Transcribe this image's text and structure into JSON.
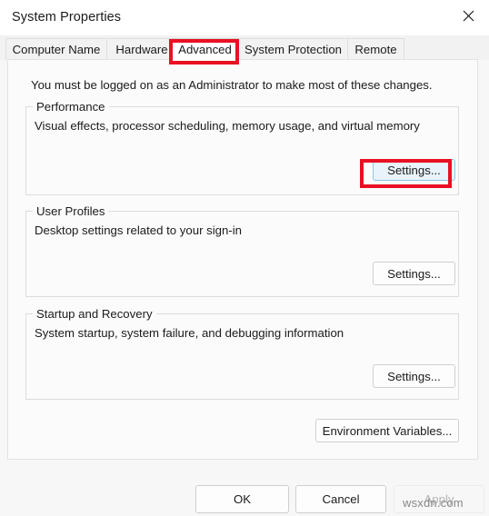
{
  "window": {
    "title": "System Properties",
    "close_icon": "close-icon"
  },
  "tabs": [
    {
      "label": "Computer Name",
      "active": false
    },
    {
      "label": "Hardware",
      "active": false
    },
    {
      "label": "Advanced",
      "active": true
    },
    {
      "label": "System Protection",
      "active": false
    },
    {
      "label": "Remote",
      "active": false
    }
  ],
  "content": {
    "admin_note": "You must be logged on as an Administrator to make most of these changes.",
    "groups": [
      {
        "legend": "Performance",
        "description": "Visual effects, processor scheduling, memory usage, and virtual memory",
        "button_label": "Settings...",
        "highlighted": true
      },
      {
        "legend": "User Profiles",
        "description": "Desktop settings related to your sign-in",
        "button_label": "Settings...",
        "highlighted": false
      },
      {
        "legend": "Startup and Recovery",
        "description": "System startup, system failure, and debugging information",
        "button_label": "Settings...",
        "highlighted": false
      }
    ],
    "environment_variables_label": "Environment Variables..."
  },
  "footer": {
    "ok_label": "OK",
    "cancel_label": "Cancel",
    "apply_label": "Apply"
  },
  "watermark": "wsxdn.com",
  "colors": {
    "annotation_red": "#e81123",
    "hover_blue_fill": "#e9f3fb",
    "hover_blue_border": "#8ec6ea"
  }
}
